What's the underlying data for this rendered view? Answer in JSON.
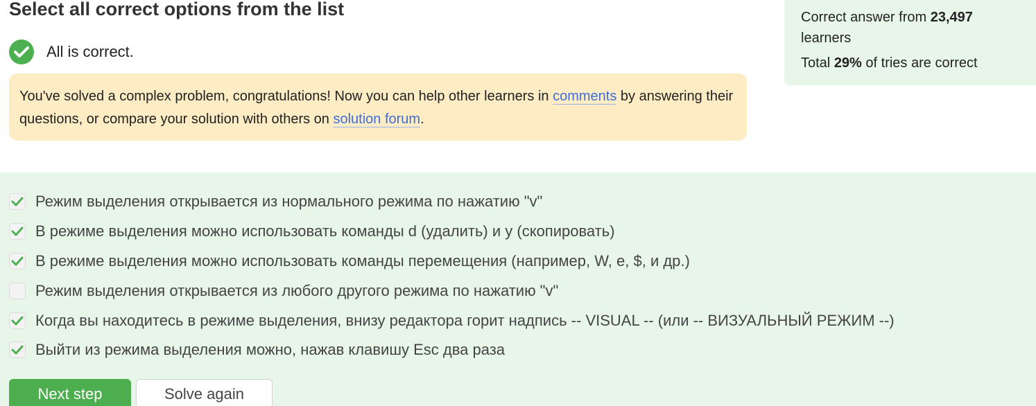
{
  "title": "Select all correct options from the list",
  "status": {
    "text": "All is correct.",
    "icon": "check-circle-icon",
    "color": "#4caf50"
  },
  "notice": {
    "text_before": "You've solved a complex problem, congratulations! Now you can help other learners in ",
    "link_comments": "comments",
    "text_middle": " by answering their questions, or compare your solution with others on ",
    "link_forum": "solution forum",
    "text_after": ".",
    "background": "#fdecc4",
    "link_color": "#3e6dd8"
  },
  "stats": {
    "line1_prefix": "Correct answer from ",
    "line1_count": "23,497",
    "line1_suffix": "learners",
    "line2_prefix": "Total ",
    "line2_percent": "29%",
    "line2_suffix": " of tries are correct"
  },
  "options": [
    {
      "label": "Режим выделения открывается из нормального режима по нажатию \"v\"",
      "checked": true
    },
    {
      "label": "В режиме выделения можно использовать команды d (удалить) и y (скопировать)",
      "checked": true
    },
    {
      "label": "В режиме выделения можно использовать команды перемещения (например, W, e, $, и др.)",
      "checked": true
    },
    {
      "label": "Режим выделения открывается из любого другого режима по нажатию \"v\"",
      "checked": false
    },
    {
      "label": "Когда вы находитесь в режиме выделения, внизу редактора горит надпись -- VISUAL -- (или -- ВИЗУАЛЬНЫЙ РЕЖИМ --)",
      "checked": true
    },
    {
      "label": "Выйти из режима выделения можно, нажав клавишу Esc два раза",
      "checked": true
    }
  ],
  "buttons": {
    "next": "Next step",
    "again": "Solve again"
  },
  "colors": {
    "answers_bg": "#e8f6ea",
    "check_green": "#4caf50",
    "next_button": "#4cae4f"
  }
}
